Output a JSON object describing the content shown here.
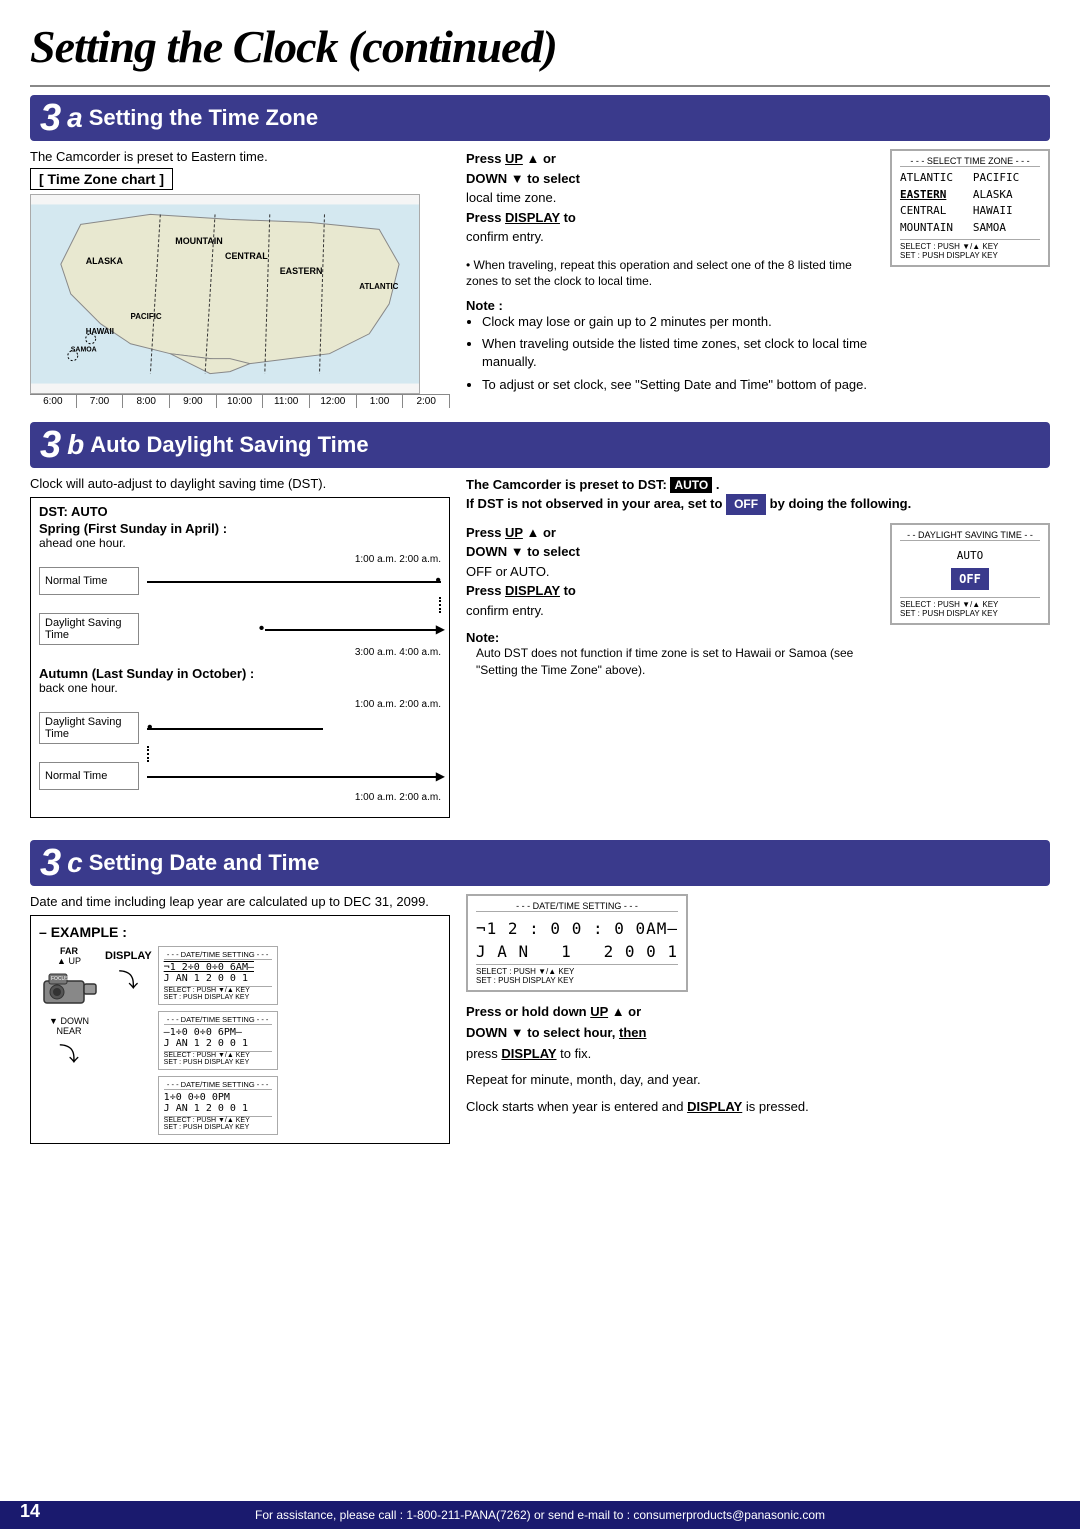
{
  "page": {
    "main_title": "Setting the Clock (continued)",
    "footer_text": "For assistance, please call : 1-800-211-PANA(7262) or send e-mail to : consumerproducts@panasonic.com",
    "page_number": "14"
  },
  "section_3a": {
    "number": "3",
    "letter": "a",
    "title": "Setting the Time Zone",
    "intro": "The Camcorder is preset to Eastern time.",
    "chart_label": "[ Time Zone chart ]",
    "map_labels": [
      "ALASKA",
      "MOUNTAIN",
      "CENTRAL",
      "EASTERN",
      "HAWAII",
      "PACIFIC",
      "ATLANTIC",
      "SAMOA"
    ],
    "timeline": [
      "6:00",
      "7:00",
      "8:00",
      "9:00",
      "10:00",
      "11:00",
      "12:00",
      "1:00",
      "2:00"
    ],
    "press_up": "Press UP ▲ or",
    "down_select": "DOWN ▼ to select",
    "local_time": "local time zone.",
    "press_display": "Press DISPLAY to",
    "confirm": "confirm entry.",
    "bullet": "When traveling, repeat this operation and select one of the 8 listed time zones to set the clock to local time.",
    "note_title": "Note :",
    "notes": [
      "Clock may lose or gain up to 2 minutes per month.",
      "When traveling outside the listed time zones, set clock to local time manually.",
      "To adjust or set clock, see \"Setting Date and Time\" bottom of page."
    ],
    "screen_title": "- - - SELECT TIME ZONE - - -",
    "screen_lines": [
      "ATLANTIC    PACIFIC",
      "EASTERN     ALASKA",
      "CENTRAL     HAWAII",
      "MOUNTAIN    SAMOA"
    ],
    "screen_eastern_underline": true,
    "screen_footer1": "SELECT : PUSH ▼/▲ KEY",
    "screen_footer2": "SET    : PUSH DISPLAY KEY"
  },
  "section_3b": {
    "number": "3",
    "letter": "b",
    "title": "Auto Daylight Saving Time",
    "intro": "Clock will auto-adjust to daylight saving time (DST).",
    "dst_box_title": "DST: AUTO",
    "spring_title": "Spring (First Sunday in April) :",
    "spring_sub": "ahead one hour.",
    "spring_times_top": "1:00 a.m.  2:00 a.m.",
    "normal_time_1": "Normal Time",
    "daylight_saving_time": "Daylight Saving Time",
    "spring_times_bottom": "3:00 a.m.  4:00 a.m.",
    "autumn_title": "Autumn (Last Sunday in October) :",
    "autumn_sub": "back one hour.",
    "autumn_times_top": "1:00 a.m.  2:00 a.m.",
    "daylight_saving_time_2": "Daylight Saving Time",
    "normal_time_2": "Normal Time",
    "autumn_times_bottom": "1:00 a.m.  2:00 a.m.",
    "preset_text": "The Camcorder is preset to DST: AUTO .",
    "if_dst_text": "If DST is not observed in your area, set to OFF by doing the following.",
    "press_up": "Press UP ▲ or",
    "down_select": "DOWN ▼ to select",
    "off_or_auto": "OFF or AUTO.",
    "press_display": "Press DISPLAY to",
    "confirm": "confirm entry.",
    "note_title": "Note:",
    "note_text": "Auto DST does not function if time zone is set to Hawaii or Samoa (see \"Setting the Time Zone\" above).",
    "screen_title": "- - DAYLIGHT SAVING TIME - -",
    "screen_auto": "AUTO",
    "screen_off": "OFF",
    "screen_footer1": "SELECT : PUSH ▼/▲ KEY",
    "screen_footer2": "SET    : PUSH DISPLAY KEY"
  },
  "section_3c": {
    "number": "3",
    "letter": "c",
    "title": "Setting Date and Time",
    "intro": "Date and time including leap year are calculated up to DEC 31, 2099.",
    "example_label": "EXAMPLE :",
    "cam_labels": [
      "FAR",
      "UP",
      "FOCUS",
      "DOWN",
      "NEAR"
    ],
    "display_label": "DISPLAY",
    "arrow_label": "↓",
    "screens": [
      {
        "title": "- - - DATE/TIME SETTING - - -",
        "line1": "¬1 2÷0 0÷0 6AM–",
        "line2": "J AN   1  2 0 0 1",
        "footer1": "SELECT : PUSH ▼/▲ KEY",
        "footer2": "SET    : PUSH DISPLAY KEY"
      },
      {
        "title": "- - - DATE/TIME SETTING - - -",
        "line1": "–1÷0 0÷0 6PM–",
        "line2": "J AN   1  2 0 0 1",
        "footer1": "SELECT : PUSH ▼/▲ KEY",
        "footer2": "SET    : PUSH DISPLAY KEY"
      },
      {
        "title": "- - - DATE/TIME SETTING - - -",
        "line1": " 1÷0 0÷0 0PM",
        "line2": "J AN  1   2 0 0 1",
        "footer1": "SELECT : PUSH ▼/▲ KEY",
        "footer2": "SET    : PUSH DISPLAY KEY"
      }
    ],
    "right_title_screen": {
      "title": "- - - DATE/TIME SETTING - - -",
      "line1": "¬1 2 : 0 0 : 0 0AM–",
      "line2": "J A N   1   2 0 0 1",
      "footer1": "SELECT : PUSH ▼/▲ KEY",
      "footer2": "SET    : PUSH DISPLAY KEY"
    },
    "press_text": "Press or hold down UP ▲ or",
    "down_text": "DOWN ▼ to select hour, then",
    "press_display": "press DISPLAY to fix.",
    "repeat_text": "Repeat for minute, month, day, and year.",
    "clock_text": "Clock starts when year is entered and DISPLAY is pressed."
  }
}
